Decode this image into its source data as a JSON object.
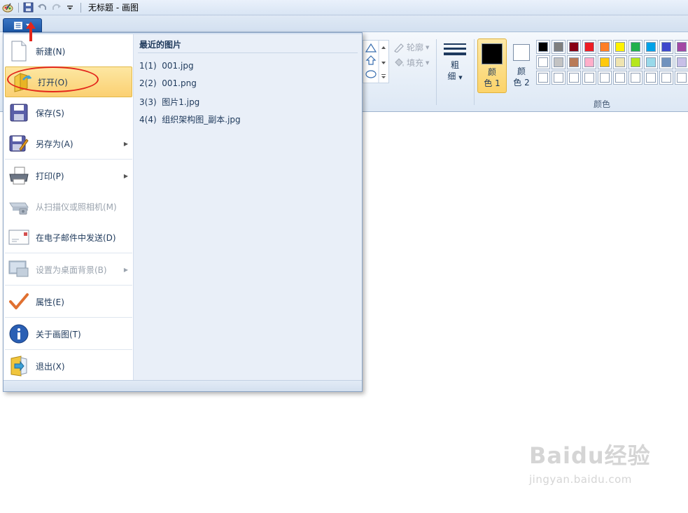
{
  "window": {
    "title": "无标题 - 画图"
  },
  "ribbon": {
    "outline_label": "轮廓",
    "fill_label": "填充",
    "size_label_1": "粗",
    "size_label_2": "细",
    "color1_label_1": "颜",
    "color1_label_2": "色 1",
    "color2_label_1": "颜",
    "color2_label_2": "色 2",
    "colors_group_label": "颜色",
    "color1_value": "#000000",
    "color2_value": "#ffffff",
    "palette": [
      "#000000",
      "#7f7f7f",
      "#880015",
      "#ed1c24",
      "#ff7f27",
      "#fff200",
      "#22b14c",
      "#00a2e8",
      "#3f48cc",
      "#a349a4",
      "#ffffff",
      "#c3c3c3",
      "#b97a57",
      "#ffaec9",
      "#ffc90e",
      "#efe4b0",
      "#b5e61d",
      "#99d9ea",
      "#7092be",
      "#c8bfe7",
      "#ffffff",
      "#ffffff",
      "#ffffff",
      "#ffffff",
      "#ffffff",
      "#ffffff",
      "#ffffff",
      "#ffffff",
      "#ffffff",
      "#ffffff"
    ]
  },
  "menu": {
    "items": [
      {
        "label": "新建(N)",
        "icon": "new-document-icon"
      },
      {
        "label": "打开(O)",
        "icon": "open-folder-icon"
      },
      {
        "label": "保存(S)",
        "icon": "save-disk-icon"
      },
      {
        "label": "另存为(A)",
        "icon": "save-as-icon"
      },
      {
        "label": "打印(P)",
        "icon": "printer-icon"
      },
      {
        "label": "从扫描仪或照相机(M)",
        "icon": "scanner-icon"
      },
      {
        "label": "在电子邮件中发送(D)",
        "icon": "email-icon"
      },
      {
        "label": "设置为桌面背景(B)",
        "icon": "desktop-icon"
      },
      {
        "label": "属性(E)",
        "icon": "checkmark-icon"
      },
      {
        "label": "关于画图(T)",
        "icon": "info-icon"
      },
      {
        "label": "退出(X)",
        "icon": "exit-icon"
      }
    ],
    "recent_title": "最近的图片",
    "recent": [
      {
        "index": "1(1)",
        "name": "001.jpg"
      },
      {
        "index": "2(2)",
        "name": "001.png"
      },
      {
        "index": "3(3)",
        "name": "图片1.jpg"
      },
      {
        "index": "4(4)",
        "name": "组织架构图_副本.jpg"
      }
    ]
  },
  "watermark": {
    "logo": "Baidu经验",
    "url": "jingyan.baidu.com"
  }
}
